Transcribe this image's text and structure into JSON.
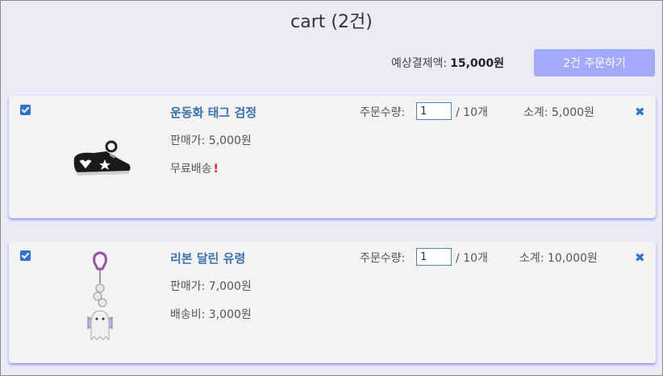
{
  "header": {
    "title": "cart (2건)"
  },
  "summary": {
    "label": "예상결제액:",
    "total": "15,000원",
    "order_button": "2건 주문하기"
  },
  "items": [
    {
      "name": "운동화 태그 검정",
      "price": "판매가: 5,000원",
      "shipping": "무료배송",
      "shipping_badge": "!",
      "qty_label": "주문수량:",
      "qty_value": "1",
      "qty_max": "/ 10개",
      "subtotal": "소계: 5,000원",
      "image_icon": "sneaker-charm"
    },
    {
      "name": "리본 달린 유령",
      "price": "판매가: 7,000원",
      "shipping": "배송비: 3,000원",
      "qty_label": "주문수량:",
      "qty_value": "1",
      "qty_max": "/ 10개",
      "subtotal": "소계: 10,000원",
      "image_icon": "ghost-keychain"
    }
  ],
  "colors": {
    "accent": "#2f71d3",
    "link": "#3a6fb0",
    "order_button": "#a3aafc",
    "background": "#ebebf8",
    "card_shadow": "#7f88f5",
    "warning": "#e02424"
  }
}
